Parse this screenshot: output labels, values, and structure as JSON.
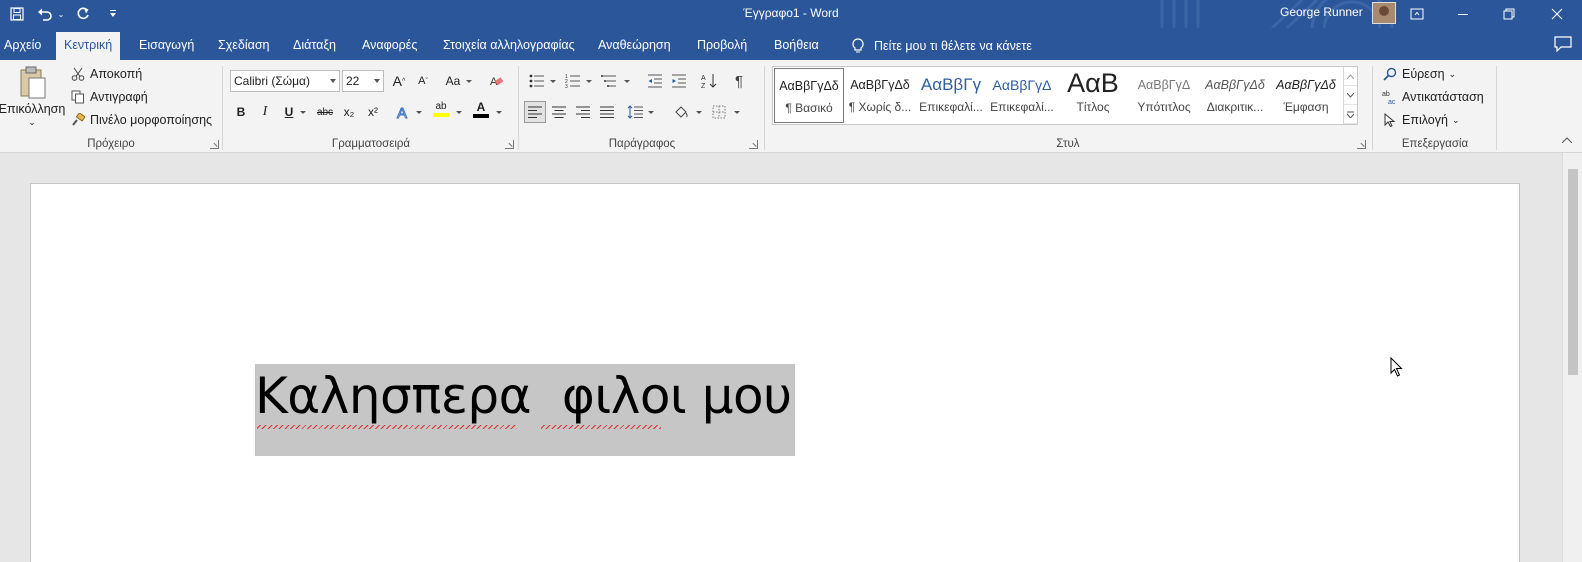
{
  "app": {
    "title": "Έγγραφο1  -  Word",
    "user_name": "George Runner"
  },
  "qat": {
    "save": "save-icon",
    "undo": "undo-icon",
    "redo": "redo-icon",
    "customize": "customize-icon"
  },
  "tabs": [
    {
      "label": "Αρχείο"
    },
    {
      "label": "Κεντρική"
    },
    {
      "label": "Εισαγωγή"
    },
    {
      "label": "Σχεδίαση"
    },
    {
      "label": "Διάταξη"
    },
    {
      "label": "Αναφορές"
    },
    {
      "label": "Στοιχεία αλληλογραφίας"
    },
    {
      "label": "Αναθεώρηση"
    },
    {
      "label": "Προβολή"
    },
    {
      "label": "Βοήθεια"
    }
  ],
  "tell_me": "Πείτε μου τι θέλετε να κάνετε",
  "clipboard": {
    "paste": "Επικόλληση",
    "cut": "Αποκοπή",
    "copy": "Αντιγραφή",
    "format_painter": "Πινέλο μορφοποίησης",
    "label": "Πρόχειρο"
  },
  "font": {
    "family": "Calibri (Σώμα)",
    "size": "22",
    "grow": "A",
    "shrink": "A",
    "change_case": "Aa",
    "bold": "B",
    "italic": "I",
    "underline": "U",
    "strikethrough": "abc",
    "subscript": "x₂",
    "superscript": "x²",
    "highlight": "ab",
    "font_color": "A",
    "label": "Γραμματοσειρά",
    "highlight_color": "#ffff00",
    "font_color_value": "#c00000"
  },
  "paragraph": {
    "label": "Παράγραφος",
    "pilcrow": "¶"
  },
  "styles": {
    "label": "Στυλ",
    "items": [
      {
        "preview": "ΑαΒβΓγΔδ",
        "name": "¶ Βασικό"
      },
      {
        "preview": "ΑαΒβΓγΔδ",
        "name": "¶ Χωρίς δ..."
      },
      {
        "preview": "ΑαΒβΓγ",
        "name": "Επικεφαλί..."
      },
      {
        "preview": "ΑαΒβΓγΔ",
        "name": "Επικεφαλί..."
      },
      {
        "preview": "ΑαΒ",
        "name": "Τίτλος"
      },
      {
        "preview": "ΑαΒβΓγΔ",
        "name": "Υπότιτλος"
      },
      {
        "preview": "ΑαΒβΓγΔδ",
        "name": "Διακριτικ..."
      },
      {
        "preview": "ΑαΒβΓγΔδ",
        "name": "Έμφαση"
      }
    ]
  },
  "editing": {
    "find": "Εύρεση",
    "replace": "Αντικατάσταση",
    "select": "Επιλογή",
    "label": "Επεξεργασία"
  },
  "document": {
    "text": "Καλησπερα  φιλοι μου"
  },
  "colors": {
    "brand": "#2b579a",
    "ribbon_bg": "#f3f3f3",
    "selection": "#c6c6c6"
  }
}
